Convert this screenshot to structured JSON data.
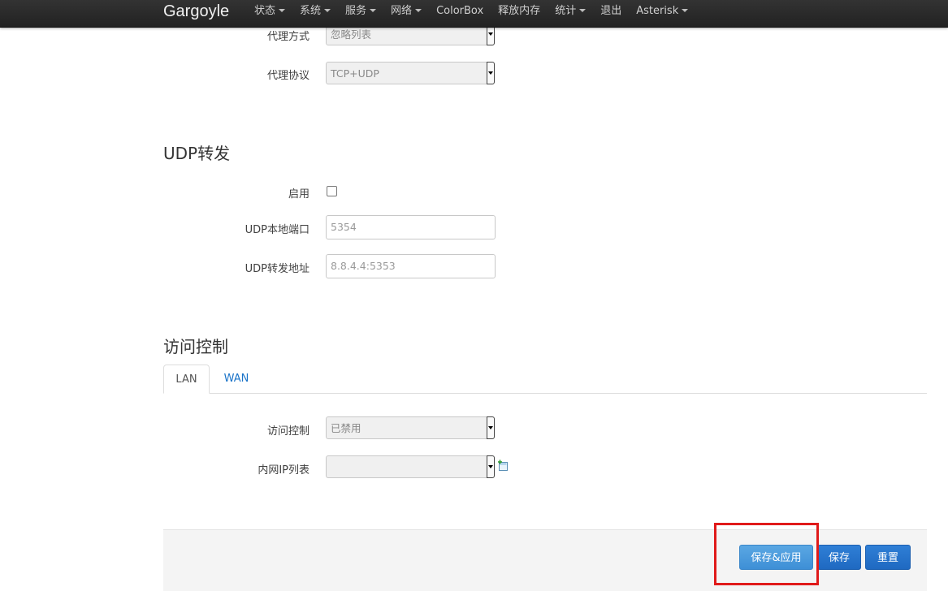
{
  "navbar": {
    "brand": "Gargoyle",
    "items": [
      {
        "label": "状态",
        "dropdown": true
      },
      {
        "label": "系统",
        "dropdown": true
      },
      {
        "label": "服务",
        "dropdown": true
      },
      {
        "label": "网络",
        "dropdown": true
      },
      {
        "label": "ColorBox",
        "dropdown": false
      },
      {
        "label": "释放内存",
        "dropdown": false
      },
      {
        "label": "统计",
        "dropdown": true
      },
      {
        "label": "退出",
        "dropdown": false
      },
      {
        "label": "Asterisk",
        "dropdown": true
      }
    ]
  },
  "proxy": {
    "mode_label": "代理方式",
    "mode_value": "忽略列表",
    "protocol_label": "代理协议",
    "protocol_value": "TCP+UDP"
  },
  "udp_forward": {
    "title": "UDP转发",
    "enable_label": "启用",
    "enable_checked": false,
    "port_label": "UDP本地端口",
    "port_placeholder": "5354",
    "addr_label": "UDP转发地址",
    "addr_placeholder": "8.8.4.4:5353"
  },
  "access_control": {
    "title": "访问控制",
    "tabs": [
      {
        "label": "LAN",
        "active": true
      },
      {
        "label": "WAN",
        "active": false
      }
    ],
    "control_label": "访问控制",
    "control_value": "已禁用",
    "ip_list_label": "内网IP列表",
    "ip_list_value": ""
  },
  "actions": {
    "save_apply": "保存&应用",
    "save": "保存",
    "reset": "重置"
  },
  "colors": {
    "navbar_bg": "#222222",
    "link": "#1a73c8",
    "primary_button": "#1f69c1",
    "apply_button": "#4a9bdc",
    "highlight": "#e01a1a"
  }
}
